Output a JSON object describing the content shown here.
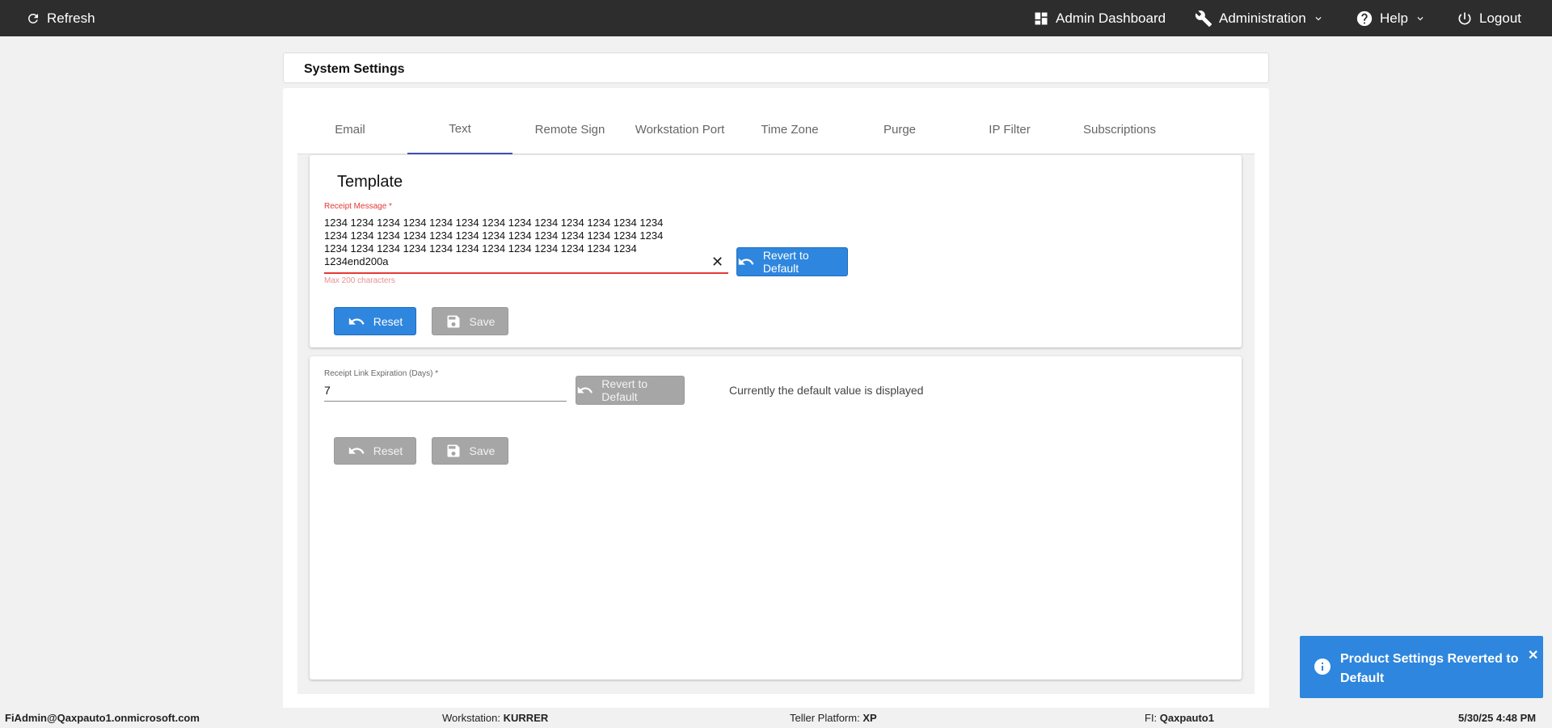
{
  "topbar": {
    "refresh": "Refresh",
    "admin_dashboard": "Admin Dashboard",
    "administration": "Administration",
    "help": "Help",
    "logout": "Logout"
  },
  "page": {
    "title": "System Settings"
  },
  "tabs": [
    {
      "label": "Email"
    },
    {
      "label": "Text",
      "active": true
    },
    {
      "label": "Remote Sign"
    },
    {
      "label": "Workstation Port"
    },
    {
      "label": "Time Zone"
    },
    {
      "label": "Purge"
    },
    {
      "label": "IP Filter"
    },
    {
      "label": "Subscriptions"
    }
  ],
  "template_card": {
    "heading": "Template",
    "field_label": "Receipt Message *",
    "field_value": "1234 1234 1234 1234 1234 1234 1234 1234 1234 1234 1234 1234 1234\n1234 1234 1234 1234 1234 1234 1234 1234 1234 1234 1234 1234 1234\n1234 1234 1234 1234 1234 1234 1234 1234 1234 1234 1234 1234\n1234end200a",
    "hint": "Max 200 characters",
    "clear_symbol": "✕",
    "revert_label": "Revert to Default",
    "reset_label": "Reset",
    "save_label": "Save"
  },
  "expire_card": {
    "field_label": "Receipt Link Expiration (Days) *",
    "field_value": "7",
    "revert_label": "Revert to Default",
    "note": "Currently the default value is displayed",
    "reset_label": "Reset",
    "save_label": "Save"
  },
  "toast": {
    "message": "Product Settings Reverted to Default",
    "close_symbol": "✕"
  },
  "statusbar": {
    "user": "FiAdmin@Qaxpauto1.onmicrosoft.com",
    "workstation_label": "Workstation:",
    "workstation_value": "KURRER",
    "teller_label": "Teller Platform:",
    "teller_value": "XP",
    "fi_label": "FI:",
    "fi_value": "Qaxpauto1",
    "datetime": "5/30/25 4:48 PM"
  },
  "colors": {
    "topbar": "#2d2d2d",
    "primary_button": "#2e86de",
    "disabled_button": "#a6a6a6",
    "active_tab": "#3f51b5",
    "error": "#e53935"
  }
}
